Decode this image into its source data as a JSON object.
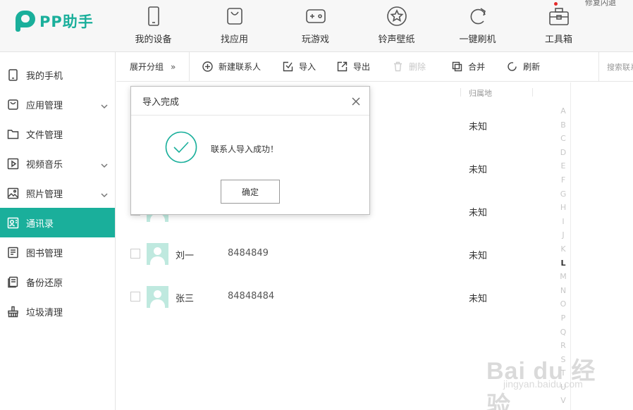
{
  "app": {
    "logo_text": "PP助手",
    "top_right_text": "修复闪退"
  },
  "nav": [
    {
      "label": "我的设备",
      "icon": "phone-icon"
    },
    {
      "label": "找应用",
      "icon": "bag-icon"
    },
    {
      "label": "玩游戏",
      "icon": "gamepad-icon"
    },
    {
      "label": "铃声壁纸",
      "icon": "star-icon"
    },
    {
      "label": "一键刷机",
      "icon": "refresh-icon"
    },
    {
      "label": "工具箱",
      "icon": "toolbox-icon"
    }
  ],
  "sidebar": {
    "items": [
      {
        "label": "我的手机",
        "icon": "phone-icon",
        "expandable": false
      },
      {
        "label": "应用管理",
        "icon": "app-bag-icon",
        "expandable": true
      },
      {
        "label": "文件管理",
        "icon": "folder-icon",
        "expandable": false
      },
      {
        "label": "视频音乐",
        "icon": "play-icon",
        "expandable": true
      },
      {
        "label": "照片管理",
        "icon": "image-icon",
        "expandable": true
      },
      {
        "label": "通讯录",
        "icon": "contacts-icon",
        "expandable": false,
        "active": true
      },
      {
        "label": "图书管理",
        "icon": "book-icon",
        "expandable": false
      },
      {
        "label": "备份还原",
        "icon": "backup-icon",
        "expandable": false
      },
      {
        "label": "垃圾清理",
        "icon": "broom-icon",
        "expandable": false
      }
    ]
  },
  "toolbar": {
    "expand_label": "展开分组",
    "expand_glyph": "»",
    "new_contact": "新建联系人",
    "import": "导入",
    "export": "导出",
    "delete": "删除",
    "merge": "合并",
    "refresh": "刷新",
    "search_placeholder": "搜索联系人"
  },
  "list": {
    "location_header": "归属地",
    "contacts": [
      {
        "name": "",
        "phone": "",
        "location": "未知"
      },
      {
        "name": "",
        "phone": "",
        "location": "未知"
      },
      {
        "name": "",
        "phone": "",
        "location": "未知"
      },
      {
        "name": "刘一",
        "phone": "8484849",
        "location": "未知"
      },
      {
        "name": "张三",
        "phone": "84848484",
        "location": "未知"
      }
    ]
  },
  "alphabet": [
    "A",
    "B",
    "C",
    "D",
    "E",
    "F",
    "G",
    "H",
    "I",
    "J",
    "K",
    "L",
    "M",
    "N",
    "O",
    "P",
    "Q",
    "R",
    "S",
    "T",
    "U",
    "V"
  ],
  "alphabet_active": "L",
  "dialog": {
    "title": "导入完成",
    "message": "联系人导入成功！",
    "confirm_label": "确定"
  },
  "watermark": {
    "text": "Bai du 经验",
    "url": "jingyan.baidu.com"
  },
  "colors": {
    "accent": "#1aaf9b",
    "sidebar_active_bg": "#1aaf9b",
    "notify_dot": "#e52b2b"
  }
}
